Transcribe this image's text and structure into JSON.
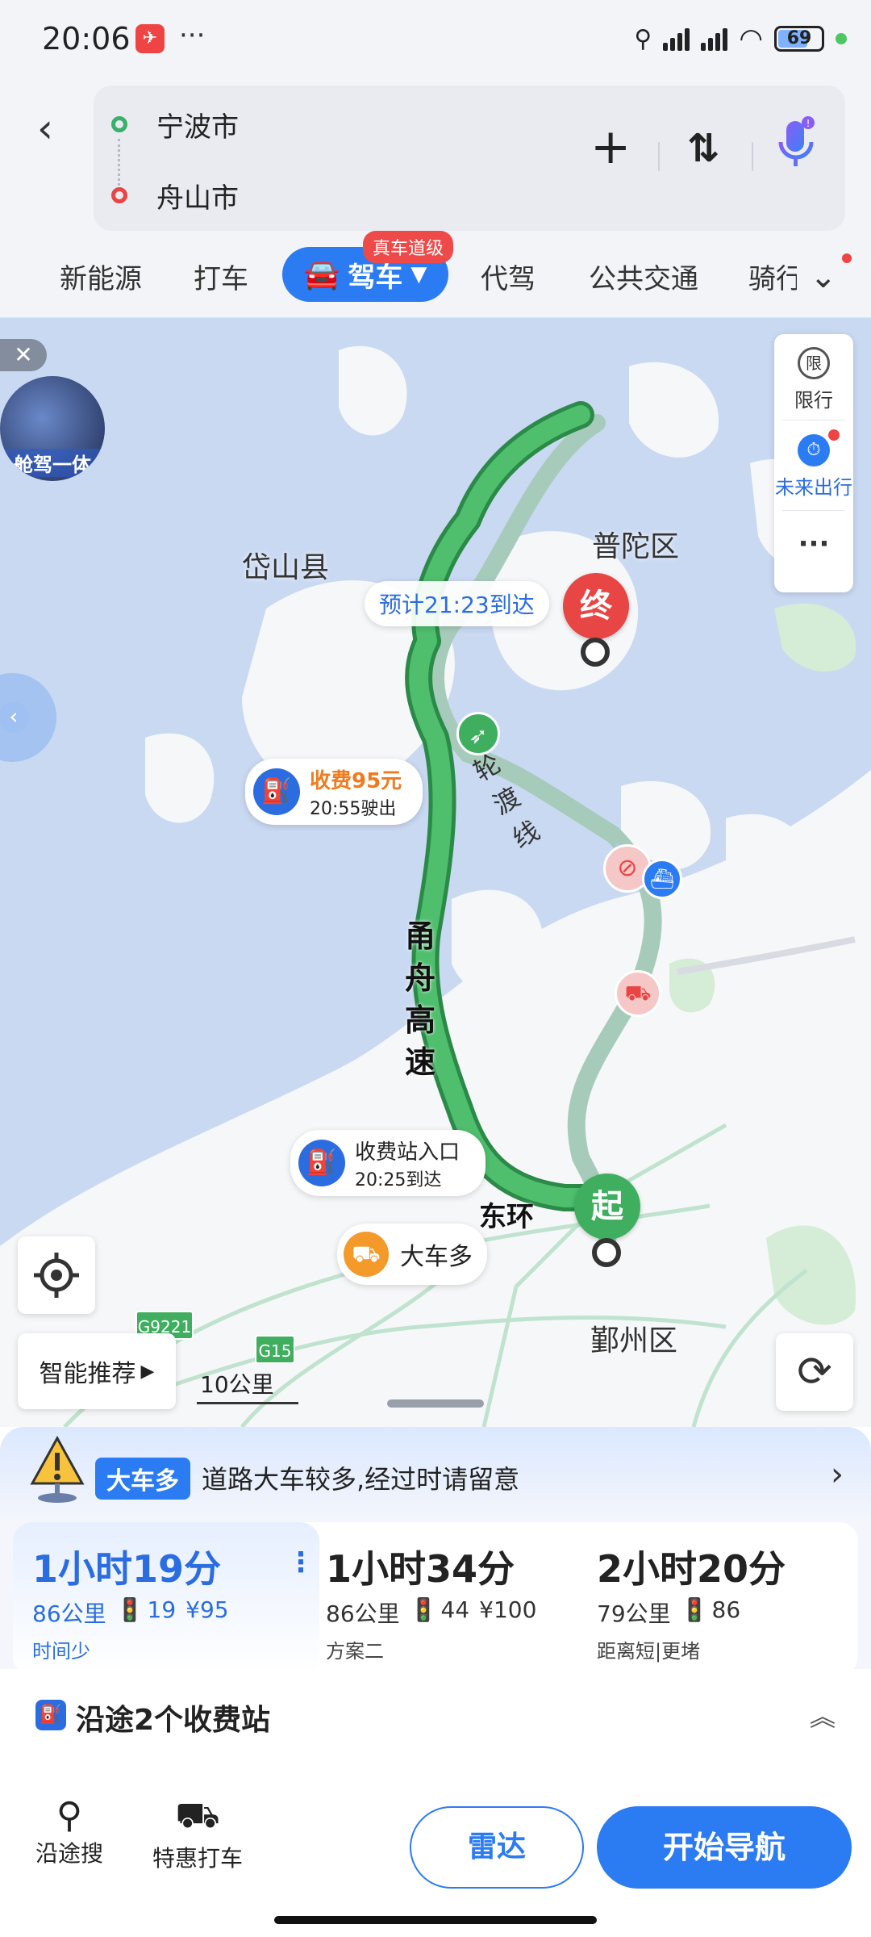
{
  "status_bar": {
    "time": "20:06",
    "more": "···",
    "battery": "69",
    "battery_level": 0.69
  },
  "route": {
    "start": "宁波市",
    "end": "舟山市"
  },
  "tabs": {
    "items": [
      "新能源",
      "打车",
      "代驾",
      "公共交通",
      "骑行"
    ],
    "active": "驾车",
    "active_badge": "真车道级"
  },
  "map": {
    "areas": [
      "岱山县",
      "普陀区",
      "鄞州区"
    ],
    "eta_bubble": "预计21:23到达",
    "end_marker": "终",
    "start_marker": "起",
    "toll_exit": {
      "title": "收费95元",
      "subtitle": "20:55驶出"
    },
    "toll_entry": {
      "title": "收费站入口",
      "subtitle": "20:25到达"
    },
    "truck_warning": "大车多",
    "road_labels": {
      "highway": "甬舟高速",
      "ferry": "轮渡线",
      "ring": "东环"
    },
    "shields": [
      "G9221",
      "G15"
    ],
    "scale": "10公里",
    "ad_label": "舱驾一体",
    "side_panel": {
      "restrict": "限行",
      "restrict_icon": "限",
      "future": "未来出行",
      "more": "···"
    },
    "smart_recommend": "智能推荐",
    "colors": {
      "route_main": "#3fae5f",
      "route_alt": "#a7cbbb",
      "water": "#c9d9f2",
      "land": "#f6f7f9"
    }
  },
  "panel": {
    "alert": {
      "chip": "大车多",
      "text": "道路大车较多,经过时请留意"
    },
    "routes": [
      {
        "time": "1小时19分",
        "distance": "86公里",
        "lights": "19",
        "fee": "¥95",
        "tag": "时间少"
      },
      {
        "time": "1小时34分",
        "distance": "86公里",
        "lights": "44",
        "fee": "¥100",
        "tag": "方案二"
      },
      {
        "time": "2小时20分",
        "distance": "79公里",
        "lights": "86",
        "fee": "",
        "tag": "距离短|更堵"
      }
    ],
    "toll_summary": "沿途2个收费站",
    "toolbar": {
      "search_along": "沿途搜",
      "discount_taxi": "特惠打车",
      "radar": "雷达",
      "start_nav": "开始导航"
    }
  }
}
